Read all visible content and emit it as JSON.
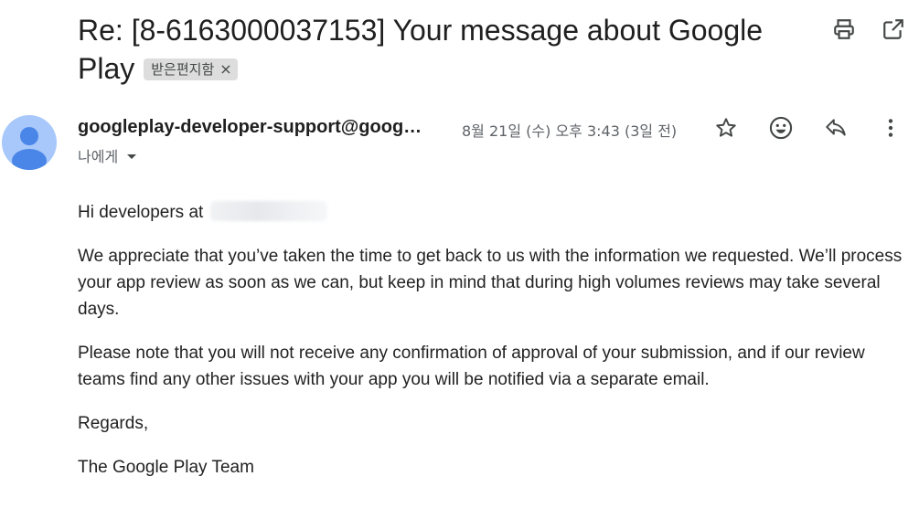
{
  "subject": {
    "text": "Re: [8-6163000037153] Your message about Google Play",
    "label": "받은편지함",
    "label_remove": "×"
  },
  "toolbar": {
    "print_icon": "printer-icon",
    "popout_icon": "open-in-new-window-icon"
  },
  "message": {
    "sender": "googleplay-developer-support@google.com",
    "sender_display": "googleplay-developer-support@goog…",
    "date": "8월 21일 (수) 오후 3:43 (3일 전)",
    "recipient": "나에게",
    "actions": [
      "star-icon",
      "emoji-icon",
      "reply-icon",
      "more-vert-icon"
    ]
  },
  "body": {
    "greeting": "Hi developers at",
    "paragraph1": "We appreciate that you’ve taken the time to get back to us with the information we requested. We’ll process your app review as soon as we can, but keep in mind that during high volumes reviews may take several days.",
    "paragraph2": "Please note that you will not receive any confirmation of approval of your submission, and if our review teams find any other issues with your app you will be notified via a separate email.",
    "regards": "Regards,",
    "signature": "The Google Play Team"
  },
  "colors": {
    "avatar_bg": "#a8c7fa",
    "avatar_fg": "#4a86e8",
    "label_bg": "#dddddd",
    "text": "#222222",
    "muted": "#5f6368"
  }
}
